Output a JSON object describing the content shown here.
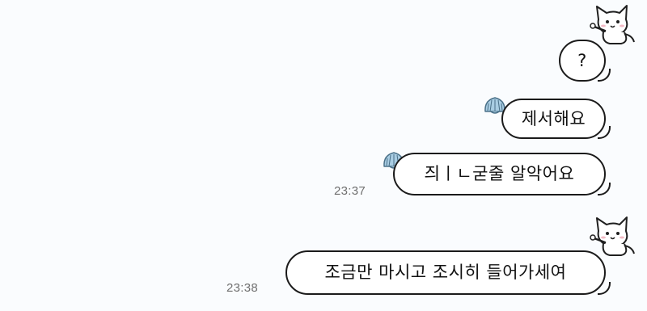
{
  "messages": [
    {
      "text": "?"
    },
    {
      "text": "제서해요"
    },
    {
      "text": "즤ㅣㄴ굳줄 알악어요",
      "time": "23:37"
    },
    {
      "text": "조금만 마시고 조시히 들어가세여",
      "time": "23:38"
    }
  ],
  "icons": {
    "avatar": "cat-sticker-icon",
    "shell": "shell-icon"
  },
  "colors": {
    "background": "#fafcfe",
    "bubble_fill": "#ffffff",
    "bubble_border": "#1b1b1b",
    "shell_blue": "#a9cde3",
    "timestamp": "#6f6f6f"
  }
}
